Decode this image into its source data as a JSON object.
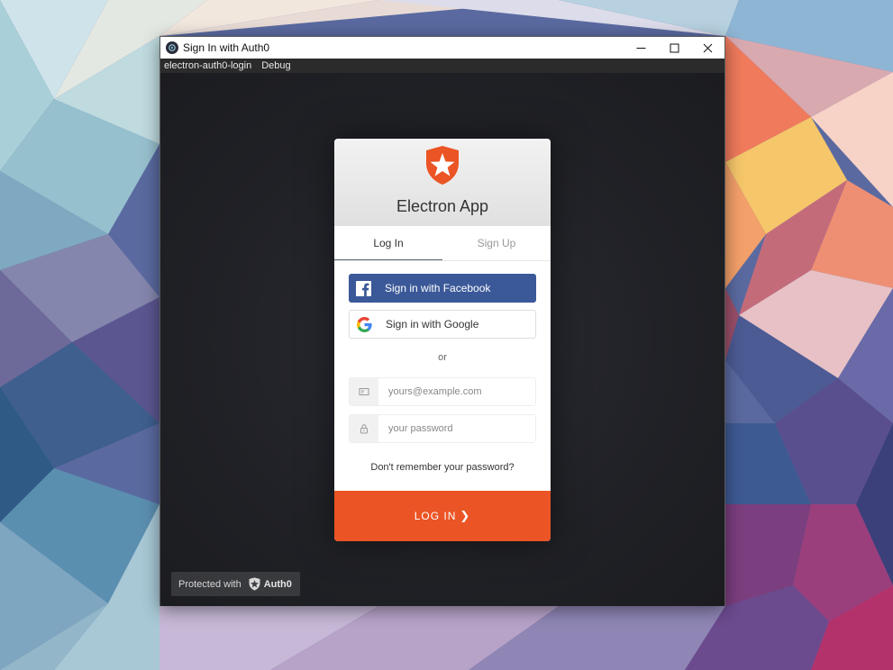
{
  "window": {
    "title": "Sign In with Auth0",
    "menu": [
      "electron-auth0-login",
      "Debug"
    ]
  },
  "lock": {
    "app_name": "Electron App",
    "tabs": [
      {
        "label": "Log In",
        "active": true
      },
      {
        "label": "Sign Up",
        "active": false
      }
    ],
    "facebook_label": "Sign in with Facebook",
    "google_label": "Sign in with Google",
    "separator": "or",
    "email_placeholder": "yours@example.com",
    "password_placeholder": "your password",
    "forgot_label": "Don't remember your password?",
    "submit_label": "LOG IN",
    "submit_icon": "chevron-right-icon"
  },
  "badge": {
    "prefix": "Protected with",
    "brand": "Auth0"
  },
  "colors": {
    "accent": "#eb5424",
    "facebook": "#3b5998"
  }
}
